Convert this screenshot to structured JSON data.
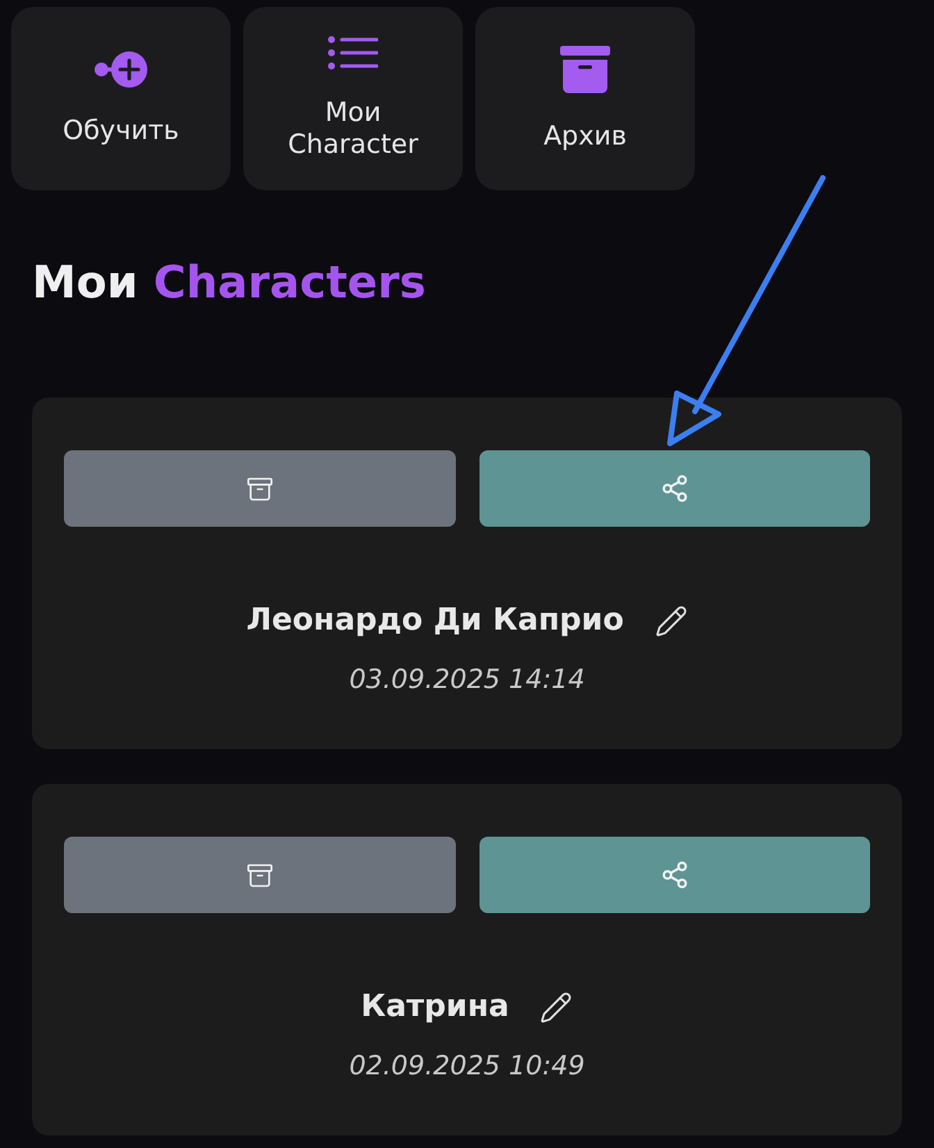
{
  "quick_actions": [
    {
      "label": "Обучить",
      "kind": "train"
    },
    {
      "label": "Мои Character",
      "kind": "list"
    },
    {
      "label": "Архив",
      "kind": "archive"
    }
  ],
  "heading": {
    "text": "Мои",
    "accent": "Characters"
  },
  "characters": [
    {
      "name": "Леонардо Ди Каприо",
      "date": "03.09.2025 14:14"
    },
    {
      "name": "Катрина",
      "date": "02.09.2025 10:49"
    }
  ]
}
